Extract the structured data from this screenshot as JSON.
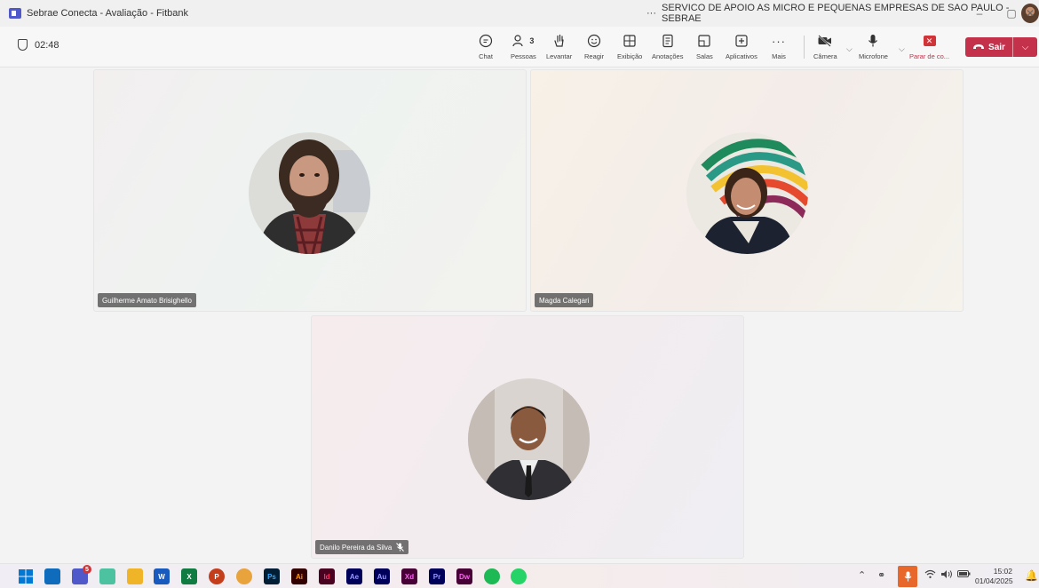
{
  "window": {
    "title": "Sebrae Conecta - Avaliação - Fitbank",
    "org_more": "···",
    "org_name": "SERVICO DE APOIO AS MICRO E PEQUENAS EMPRESAS DE SAO PAULO - SEBRAE",
    "minimize": "–",
    "restore": "▢",
    "close": "✕"
  },
  "meeting": {
    "timer": "02:48",
    "tools": {
      "chat": "Chat",
      "people": "Pessoas",
      "people_count": "3",
      "raise": "Levantar",
      "react": "Reagir",
      "view": "Exibição",
      "notes": "Anotações",
      "rooms": "Salas",
      "apps": "Aplicativos",
      "more": "Mais",
      "camera": "Câmera",
      "mic": "Microfone",
      "stop_share": "Parar de co..."
    },
    "leave_label": "Sair"
  },
  "participants": [
    {
      "name": "Guilherme Amato Brisighello"
    },
    {
      "name": "Magda Calegari"
    },
    {
      "name": "Danilo Pereira da Silva"
    }
  ],
  "taskbar": {
    "apps": [
      {
        "icon": "start-icon",
        "color": "#0078d4"
      },
      {
        "icon": "outlook-icon",
        "color": "#0f6cbd"
      },
      {
        "icon": "teams-icon",
        "color": "#5059c9",
        "badge": "5"
      },
      {
        "icon": "snipping-icon",
        "color": "#4cc2a0"
      },
      {
        "icon": "explorer-icon",
        "color": "#f0b429"
      },
      {
        "icon": "word-icon",
        "color": "#185abd",
        "text": "W"
      },
      {
        "icon": "excel-icon",
        "color": "#107c41",
        "text": "X"
      },
      {
        "icon": "powerpoint-icon",
        "color": "#c43e1c",
        "text": "P"
      },
      {
        "icon": "chrome-icon",
        "color": "#e8a33d"
      },
      {
        "icon": "photoshop-icon",
        "color": "#001e36",
        "text": "Ps",
        "fg": "#31a8ff"
      },
      {
        "icon": "illustrator-icon",
        "color": "#330000",
        "text": "Ai",
        "fg": "#ff9a00"
      },
      {
        "icon": "indesign-icon",
        "color": "#49021f",
        "text": "Id",
        "fg": "#ff3366"
      },
      {
        "icon": "aftereffects-icon",
        "color": "#00005b",
        "text": "Ae",
        "fg": "#9999ff"
      },
      {
        "icon": "audition-icon",
        "color": "#00005b",
        "text": "Au",
        "fg": "#9999ff"
      },
      {
        "icon": "xd-icon",
        "color": "#470137",
        "text": "Xd",
        "fg": "#ff61f6"
      },
      {
        "icon": "premiere-icon",
        "color": "#00005b",
        "text": "Pr",
        "fg": "#9999ff"
      },
      {
        "icon": "dreamweaver-icon",
        "color": "#470137",
        "text": "Dw",
        "fg": "#ff61f6"
      },
      {
        "icon": "spotify-icon",
        "color": "#1db954"
      },
      {
        "icon": "whatsapp-icon",
        "color": "#25d366"
      }
    ],
    "time": "15:02",
    "date": "01/04/2025"
  }
}
